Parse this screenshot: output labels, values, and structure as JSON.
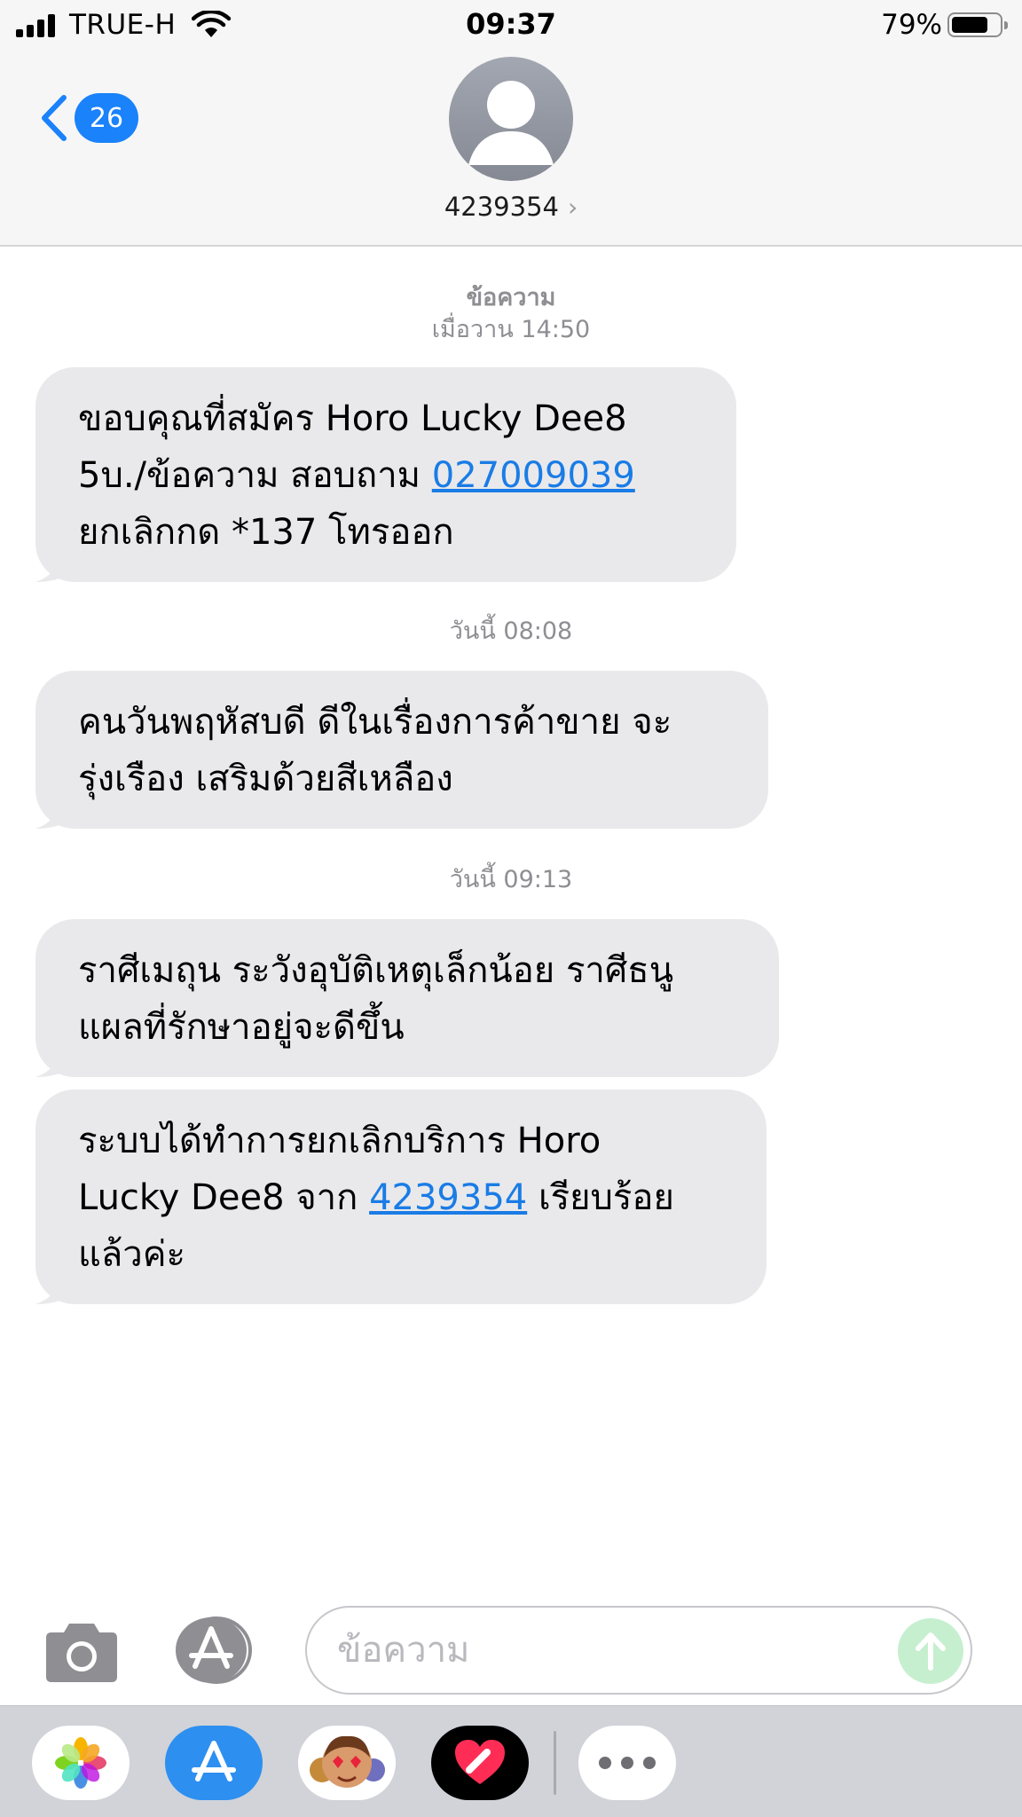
{
  "status_bar": {
    "carrier": "TRUE-H",
    "time": "09:37",
    "battery_percent_text": "79%",
    "battery_level": 0.79,
    "icons": [
      "cellular-signal-icon",
      "wifi-icon",
      "battery-icon"
    ]
  },
  "header": {
    "back_badge_count": "26",
    "contact_name": "4239354",
    "contact_chevron": "›"
  },
  "conversation": {
    "blocks": [
      {
        "timestamp_title": "ข้อความ",
        "timestamp": "เมื่อวาน 14:50"
      },
      {
        "timestamp": "วันนี้ 08:08"
      },
      {
        "timestamp": "วันนี้ 09:13"
      }
    ],
    "messages": [
      {
        "line1": "ขอบคุณที่สมัคร Horo Lucky Dee8",
        "line2_before": "5บ./ข้อความ สอบถาม ",
        "line2_link": "027009039",
        "line3": "ยกเลิกกด *137 โทรออก"
      },
      {
        "line1": "คนวันพฤหัสบดี ดีในเรื่องการค้าขาย จะ",
        "line2": "รุ่งเรือง เสริมด้วยสีเหลือง"
      },
      {
        "line1": "ราศีเมถุน ระวังอุบัติเหตุเล็กน้อย ราศีธนู",
        "line2": "แผลที่รักษาอยู่จะดีขึ้น"
      },
      {
        "line1": "ระบบได้ทำการยกเลิกบริการ Horo",
        "line2_before": "Lucky Dee8 จาก ",
        "line2_link": "4239354",
        "line2_after": " เรียบร้อย",
        "line3": "แล้วค่ะ"
      }
    ]
  },
  "composer": {
    "placeholder": "ข้อความ",
    "value": ""
  },
  "colors": {
    "accent": "#1a82fb",
    "bubble": "#e9e9eb",
    "link": "#1a7ce6",
    "send_disabled": "#c6efcf"
  },
  "app_drawer": {
    "apps": [
      "photos-app-icon",
      "app-store-icon",
      "memoji-stickers-icon",
      "digital-touch-icon",
      "more-apps-icon"
    ]
  }
}
